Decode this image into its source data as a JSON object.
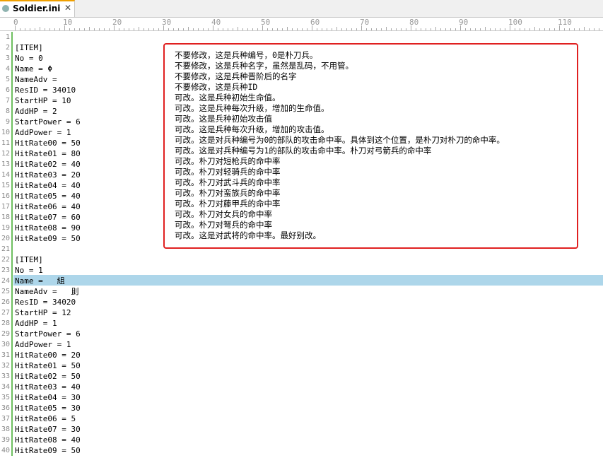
{
  "tab": {
    "label": "Soldier.ini",
    "close": "✕"
  },
  "ruler": {
    "labels": [
      "0",
      "10",
      "20",
      "30",
      "40",
      "50",
      "60",
      "70",
      "80",
      "90",
      "100",
      "110"
    ]
  },
  "lines": [
    {
      "n": "1",
      "t": ""
    },
    {
      "n": "2",
      "t": "[ITEM]"
    },
    {
      "n": "3",
      "t": "No = 0"
    },
    {
      "n": "4",
      "t": "Name = Φ"
    },
    {
      "n": "5",
      "t": "NameAdv ="
    },
    {
      "n": "6",
      "t": "ResID = 34010"
    },
    {
      "n": "7",
      "t": "StartHP = 10"
    },
    {
      "n": "8",
      "t": "AddHP = 2"
    },
    {
      "n": "9",
      "t": "StartPower = 6"
    },
    {
      "n": "10",
      "t": "AddPower = 1"
    },
    {
      "n": "11",
      "t": "HitRate00 = 50"
    },
    {
      "n": "12",
      "t": "HitRate01 = 80"
    },
    {
      "n": "13",
      "t": "HitRate02 = 40"
    },
    {
      "n": "14",
      "t": "HitRate03 = 20"
    },
    {
      "n": "15",
      "t": "HitRate04 = 40"
    },
    {
      "n": "16",
      "t": "HitRate05 = 40"
    },
    {
      "n": "17",
      "t": "HitRate06 = 40"
    },
    {
      "n": "18",
      "t": "HitRate07 = 60"
    },
    {
      "n": "19",
      "t": "HitRate08 = 90"
    },
    {
      "n": "20",
      "t": "HitRate09 = 50"
    },
    {
      "n": "21",
      "t": ""
    },
    {
      "n": "22",
      "t": "[ITEM]"
    },
    {
      "n": "23",
      "t": "No = 1"
    },
    {
      "n": "24",
      "t": "Name =   組"
    },
    {
      "n": "25",
      "t": "NameAdv =   刞"
    },
    {
      "n": "26",
      "t": "ResID = 34020"
    },
    {
      "n": "27",
      "t": "StartHP = 12"
    },
    {
      "n": "28",
      "t": "AddHP = 1"
    },
    {
      "n": "29",
      "t": "StartPower = 6"
    },
    {
      "n": "30",
      "t": "AddPower = 1"
    },
    {
      "n": "31",
      "t": "HitRate00 = 20"
    },
    {
      "n": "32",
      "t": "HitRate01 = 50"
    },
    {
      "n": "33",
      "t": "HitRate02 = 50"
    },
    {
      "n": "34",
      "t": "HitRate03 = 40"
    },
    {
      "n": "35",
      "t": "HitRate04 = 30"
    },
    {
      "n": "36",
      "t": "HitRate05 = 30"
    },
    {
      "n": "37",
      "t": "HitRate06 = 5"
    },
    {
      "n": "38",
      "t": "HitRate07 = 30"
    },
    {
      "n": "39",
      "t": "HitRate08 = 40"
    },
    {
      "n": "40",
      "t": "HitRate09 = 50"
    }
  ],
  "annotations": [
    "不要修改，这是兵种编号，0是朴刀兵。",
    "不要修改，这是兵种名字，虽然是乱码，不用管。",
    "不要修改，这是兵种晋阶后的名字",
    "不要修改，这是兵种ID",
    "可改。这是兵种初始生命值。",
    "可改。这是兵种每次升级，增加的生命值。",
    "可改。这是兵种初始攻击值",
    "可改。这是兵种每次升级，增加的攻击值。",
    "可改。这是对兵种编号为0的部队的攻击命中率。具体到这个位置，是朴刀对朴刀的命中率。",
    "可改。这是对兵种编号为1的部队的攻击命中率。朴刀对弓箭兵的命中率",
    "可改。朴刀对短枪兵的命中率",
    "可改。朴刀对轻骑兵的命中率",
    "可改。朴刀对武斗兵的命中率",
    "可改。朴刀对蛮族兵的命中率",
    "可改。朴刀对藤甲兵的命中率",
    "可改。朴刀对女兵的命中率",
    "可改。朴刀对弩兵的命中率",
    "可改。这是对武将的命中率。最好别改。"
  ]
}
